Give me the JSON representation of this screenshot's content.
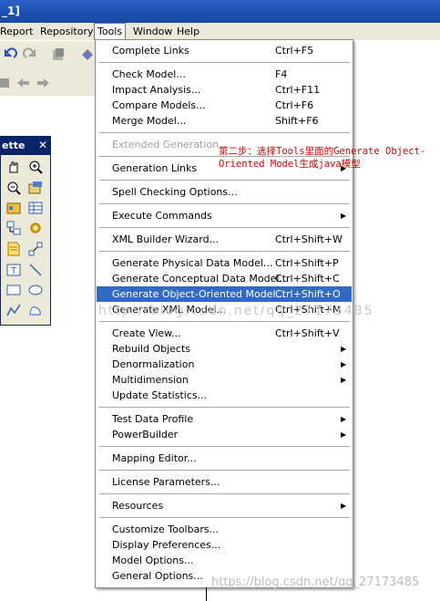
{
  "window": {
    "title_fragment": "_1]"
  },
  "menubar": {
    "items": [
      {
        "label": "Report",
        "mnemonic_underline": "R"
      },
      {
        "label": "Repository",
        "mnemonic_underline": "R"
      },
      {
        "label": "Tools",
        "mnemonic_underline": "T",
        "open": true
      },
      {
        "label": "Window",
        "mnemonic_underline": "W"
      },
      {
        "label": "Help",
        "mnemonic_underline": "H"
      }
    ]
  },
  "palette": {
    "title": "ette",
    "close_glyph": "✕",
    "icons": [
      "grabber-hand-icon",
      "zoom-in-icon",
      "zoom-out-icon",
      "open-package-icon",
      "package-icon",
      "table-icon",
      "class-icon",
      "gear-icon",
      "note-icon",
      "link-icon",
      "text-icon",
      "line-icon",
      "rectangle-icon",
      "ellipse-icon",
      "polyline-icon",
      "freeform-icon"
    ]
  },
  "tools_menu": {
    "items": [
      {
        "label": "Complete Links",
        "shortcut": "Ctrl+F5"
      },
      {
        "sep": true
      },
      {
        "label": "Check Model...",
        "shortcut": "F4"
      },
      {
        "label": "Impact Analysis...",
        "shortcut": "Ctrl+F11"
      },
      {
        "label": "Compare Models...",
        "shortcut": "Ctrl+F6"
      },
      {
        "label": "Merge Model...",
        "shortcut": "Shift+F6"
      },
      {
        "sep": true
      },
      {
        "label": "Extended Generation...",
        "shortcut": "",
        "disabled": true
      },
      {
        "sep": true
      },
      {
        "label": "Generation Links",
        "shortcut": "",
        "submenu": true
      },
      {
        "sep": true
      },
      {
        "label": "Spell Checking Options...",
        "shortcut": ""
      },
      {
        "sep": true
      },
      {
        "label": "Execute Commands",
        "shortcut": "",
        "submenu": true
      },
      {
        "sep": true
      },
      {
        "label": "XML Builder Wizard...",
        "shortcut": "Ctrl+Shift+W"
      },
      {
        "sep": true
      },
      {
        "label": "Generate Physical Data Model...",
        "shortcut": "Ctrl+Shift+P"
      },
      {
        "label": "Generate Conceptual Data Model...",
        "shortcut": "Ctrl+Shift+C"
      },
      {
        "label": "Generate Object-Oriented Model...",
        "shortcut": "Ctrl+Shift+O",
        "highlighted": true
      },
      {
        "label": "Generate XML Model...",
        "shortcut": "Ctrl+Shift+M"
      },
      {
        "sep": true
      },
      {
        "label": "Create View...",
        "shortcut": "Ctrl+Shift+V"
      },
      {
        "label": "Rebuild Objects",
        "shortcut": "",
        "submenu": true
      },
      {
        "label": "Denormalization",
        "shortcut": "",
        "submenu": true
      },
      {
        "label": "Multidimension",
        "shortcut": "",
        "submenu": true
      },
      {
        "label": "Update Statistics...",
        "shortcut": ""
      },
      {
        "sep": true
      },
      {
        "label": "Test Data Profile",
        "shortcut": "",
        "submenu": true
      },
      {
        "label": "PowerBuilder",
        "shortcut": "",
        "submenu": true
      },
      {
        "sep": true
      },
      {
        "label": "Mapping Editor...",
        "shortcut": ""
      },
      {
        "sep": true
      },
      {
        "label": "License Parameters...",
        "shortcut": ""
      },
      {
        "sep": true
      },
      {
        "label": "Resources",
        "shortcut": "",
        "submenu": true
      },
      {
        "sep": true
      },
      {
        "label": "Customize Toolbars...",
        "shortcut": ""
      },
      {
        "label": "Display Preferences...",
        "shortcut": ""
      },
      {
        "label": "Model Options...",
        "shortcut": ""
      },
      {
        "label": "General Options...",
        "shortcut": ""
      }
    ]
  },
  "annotation": {
    "line1": "第二步：选择Tools里面的Generate Object-",
    "line2": "Oriented Model生成java模型",
    "color": "#dd0000"
  },
  "watermarks": {
    "center": "http://blog.csdn.net/qq_27173485",
    "bottom": "https://blog.csdn.net/qq_27173485"
  },
  "colors": {
    "highlight": "#316ac5",
    "titlebar": "#1d4fb0",
    "menu_bg": "#ece9d8"
  }
}
